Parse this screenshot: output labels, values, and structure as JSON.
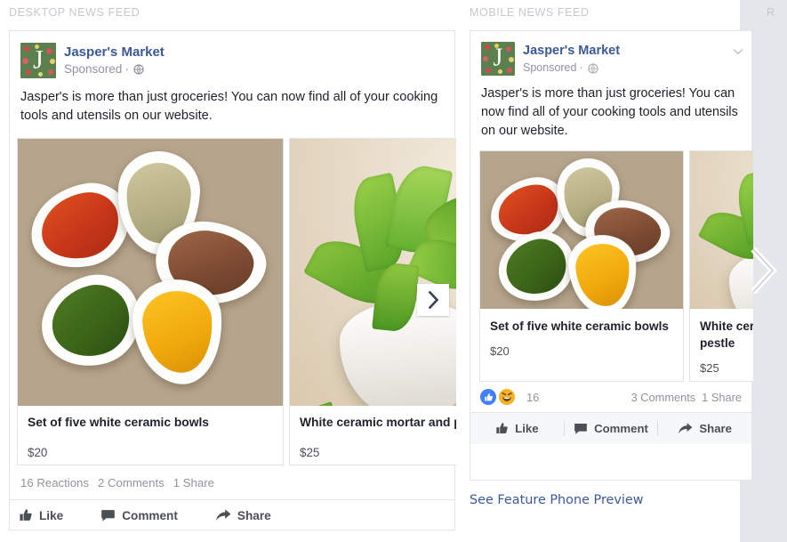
{
  "columns": {
    "desktop_label": "DESKTOP NEWS FEED",
    "mobile_label": "MOBILE NEWS FEED",
    "right_label": "R"
  },
  "colors": {
    "link_blue": "#3b5998",
    "muted_gray": "#90949c",
    "text_dark": "#1d2129",
    "reaction_like_blue": "#4080ff",
    "reaction_haha_yellow": "#f7b125",
    "card_border": "#e3e5e8",
    "page_bg": "#ffffff",
    "right_panel_bg": "#e4e6eb"
  },
  "desktop_post": {
    "page_name": "Jasper's Market",
    "sponsored_label": "Sponsored",
    "separator": "·",
    "privacy_icon": "globe-icon",
    "body_text": "Jasper's is more than just groceries! You can now find all of your cooking tools and utensils on our website.",
    "carousel": {
      "next_icon": "chevron-right-icon",
      "items": [
        {
          "title": "Set of five white ceramic bowls",
          "price": "$20",
          "image": "spice-bowls-photo"
        },
        {
          "title": "White ceramic mortar and pestle",
          "price": "$25",
          "image": "mint-mortar-photo"
        }
      ]
    },
    "counts": {
      "reactions": "16 Reactions",
      "comments": "2 Comments",
      "shares": "1 Share"
    },
    "actions": [
      {
        "label": "Like",
        "icon": "thumbs-up-icon"
      },
      {
        "label": "Comment",
        "icon": "comment-bubble-icon"
      },
      {
        "label": "Share",
        "icon": "share-arrow-icon"
      }
    ]
  },
  "mobile_post": {
    "page_name": "Jasper's Market",
    "sponsored_label": "Sponsored",
    "separator": "·",
    "privacy_icon": "globe-icon",
    "menu_icon": "chevron-down-icon",
    "body_text": "Jasper's is more than just groceries! You can now find all of your cooking tools and utensils on our website.",
    "carousel": {
      "items": [
        {
          "title": "Set of five white ceramic bowls",
          "price": "$20",
          "image": "spice-bowls-photo"
        },
        {
          "title": "White ceramic mortar and pestle",
          "price": "$25",
          "image": "mint-mortar-photo"
        }
      ]
    },
    "counts": {
      "reaction_icons": [
        "like-reaction-icon",
        "haha-reaction-icon"
      ],
      "reaction_count": "16",
      "comments": "3 Comments",
      "shares": "1 Share"
    },
    "actions": [
      {
        "label": "Like",
        "icon": "thumbs-up-icon"
      },
      {
        "label": "Comment",
        "icon": "comment-bubble-icon"
      },
      {
        "label": "Share",
        "icon": "share-arrow-icon"
      }
    ],
    "feature_phone_link": "See Feature Phone Preview"
  },
  "carousel_nav": {
    "outer_next_icon": "chevron-right-large-icon"
  }
}
